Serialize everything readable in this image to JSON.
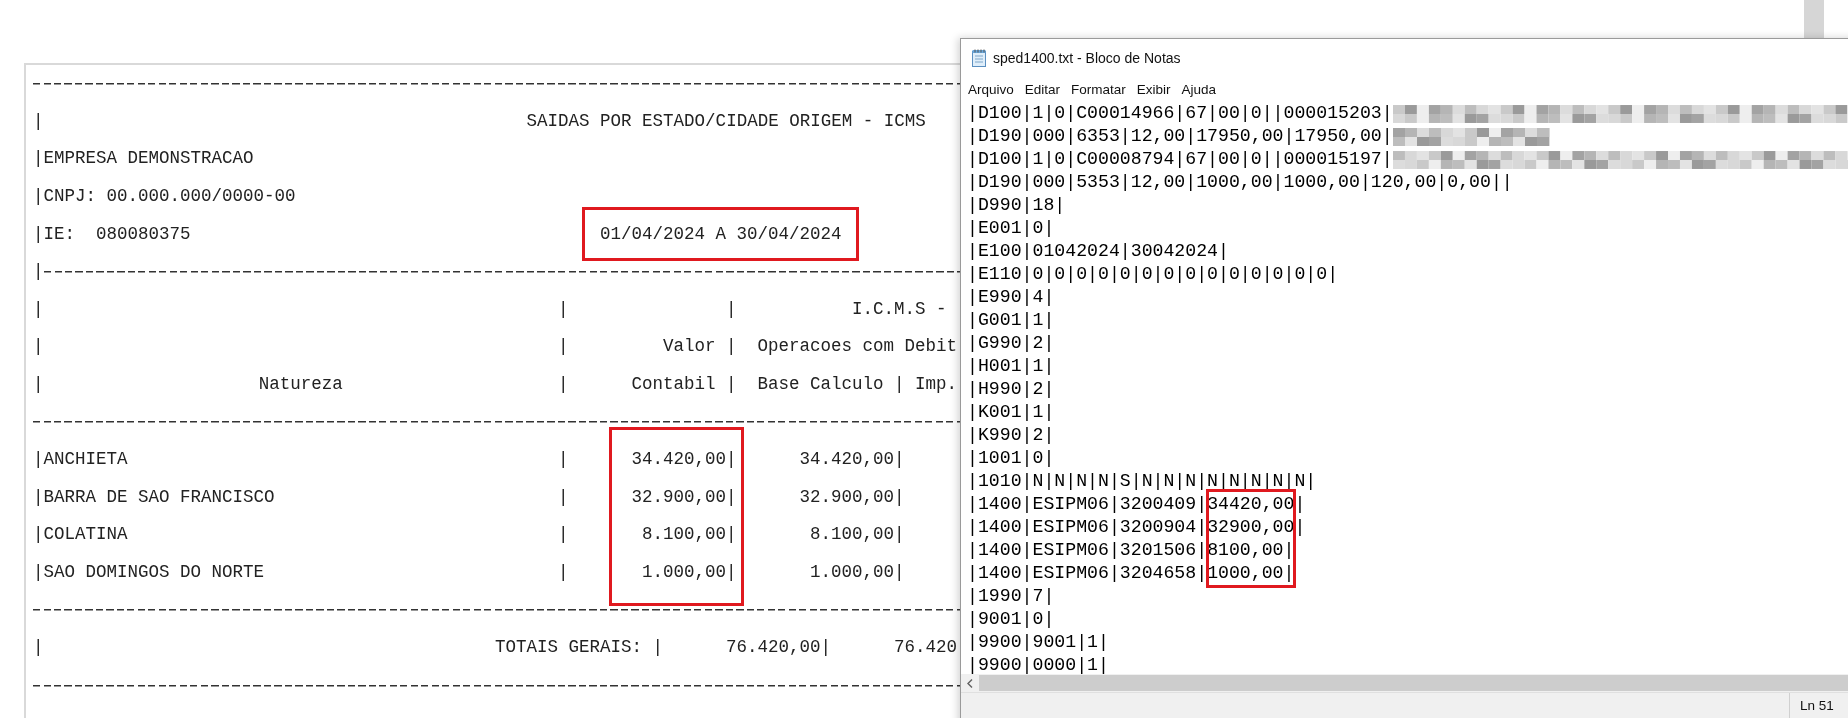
{
  "report": {
    "title_lead": "|",
    "title": "SAIDAS POR ESTADO/CIDADE ORIGEM - ICMS",
    "company": "|EMPRESA DEMONSTRACAO",
    "cnpj": "|CNPJ: 00.000.000/0000-00",
    "ie_label": "|IE:",
    "ie": "080080375",
    "period": {
      "text": "01/04/2024 A 30/04/2024",
      "highlighted": true
    },
    "rule_lead": "|",
    "header_rows": [
      {
        "cells": [
          {
            "kind": "lead",
            "text": "|"
          },
          {
            "kind": "sep",
            "text": "|"
          },
          {
            "kind": "valor",
            "text": "|"
          },
          {
            "kind": "group_title",
            "text": "I.C.M.S -"
          }
        ]
      },
      {
        "cells": [
          {
            "kind": "lead",
            "text": "|"
          },
          {
            "kind": "sep",
            "text": "|"
          },
          {
            "kind": "valor",
            "text": "Valor |"
          },
          {
            "kind": "group",
            "text": "Operacoes com Debit"
          }
        ]
      },
      {
        "cells": [
          {
            "kind": "lead",
            "text": "|"
          },
          {
            "kind": "name",
            "text": "Natureza"
          },
          {
            "kind": "sep",
            "text": "|"
          },
          {
            "kind": "valor",
            "text": "Contabil |"
          },
          {
            "kind": "base",
            "text": "Base Calculo |"
          },
          {
            "kind": "rest",
            "text": "Imp."
          }
        ]
      }
    ],
    "valor_highlighted": true,
    "rows": [
      {
        "name": "|ANCHIETA",
        "sep": "|",
        "valor": "34.420,00|",
        "base": "34.420,00|"
      },
      {
        "name": "|BARRA DE SAO FRANCISCO",
        "sep": "|",
        "valor": "32.900,00|",
        "base": "32.900,00|"
      },
      {
        "name": "|COLATINA",
        "sep": "|",
        "valor": "8.100,00|",
        "base": "8.100,00|"
      },
      {
        "name": "|SAO DOMINGOS DO NORTE",
        "sep": "|",
        "valor": "1.000,00|",
        "base": "1.000,00|"
      }
    ],
    "totals": {
      "lead": "|",
      "label": "TOTAIS GERAIS: |",
      "valor": "76.420,00|",
      "base": "76.420"
    }
  },
  "notepad": {
    "title": "sped1400.txt - Bloco de Notas",
    "menu": [
      "Arquivo",
      "Editar",
      "Formatar",
      "Exibir",
      "Ajuda"
    ],
    "value_highlighted": true,
    "lines": [
      {
        "kind": "text",
        "text": "|D100|1|0|C00014966|67|00|0||000015203|",
        "redacted": {
          "kind": "long"
        }
      },
      {
        "kind": "text",
        "text": "|D190|000|6353|12,00|17950,00|17950,00|",
        "redacted": {
          "kind": "short"
        }
      },
      {
        "kind": "text",
        "text": "|D100|1|0|C00008794|67|00|0||000015197|",
        "redacted": {
          "kind": "long"
        }
      },
      {
        "kind": "text",
        "text": "|D190|000|5353|12,00|1000,00|1000,00|120,00|0,00||"
      },
      {
        "kind": "text",
        "text": "|D990|18|"
      },
      {
        "kind": "text",
        "text": "|E001|0|"
      },
      {
        "kind": "text",
        "text": "|E100|01042024|30042024|"
      },
      {
        "kind": "text",
        "text": "|E110|0|0|0|0|0|0|0|0|0|0|0|0|0|0|"
      },
      {
        "kind": "text",
        "text": "|E990|4|"
      },
      {
        "kind": "text",
        "text": "|G001|1|"
      },
      {
        "kind": "text",
        "text": "|G990|2|"
      },
      {
        "kind": "text",
        "text": "|H001|1|"
      },
      {
        "kind": "text",
        "text": "|H990|2|"
      },
      {
        "kind": "text",
        "text": "|K001|1|"
      },
      {
        "kind": "text",
        "text": "|K990|2|"
      },
      {
        "kind": "text",
        "text": "|1001|0|"
      },
      {
        "kind": "text",
        "text": "|1010|N|N|N|N|S|N|N|N|N|N|N|N|N|"
      },
      {
        "kind": "split",
        "text": "|1400|ESIPM06|3200409|",
        "value": "34420,00|"
      },
      {
        "kind": "split",
        "text": "|1400|ESIPM06|3200904|",
        "value": "32900,00|"
      },
      {
        "kind": "split",
        "text": "|1400|ESIPM06|3201506|",
        "value": "8100,00|"
      },
      {
        "kind": "split",
        "text": "|1400|ESIPM06|3204658|",
        "value": "1000,00|"
      },
      {
        "kind": "text",
        "text": "|1990|7|"
      },
      {
        "kind": "text",
        "text": "|9001|0|"
      },
      {
        "kind": "text",
        "text": "|9900|9001|1|"
      },
      {
        "kind": "text",
        "text": "|9900|0000|1|"
      }
    ],
    "status": "Ln 51"
  }
}
